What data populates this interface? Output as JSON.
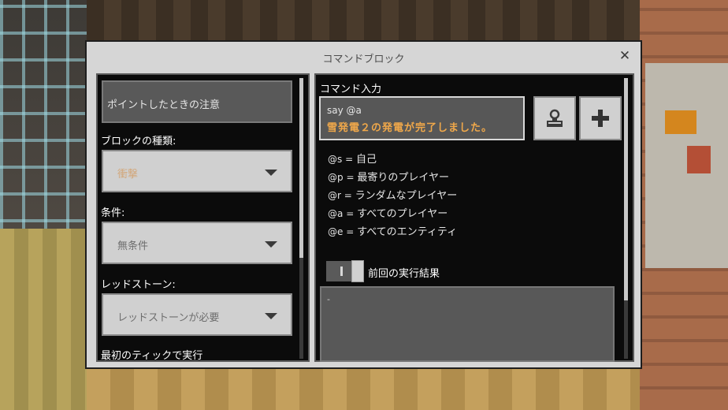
{
  "dialog": {
    "title": "コマンドブロック",
    "close_glyph": "✕"
  },
  "left": {
    "hover_note": "ポイントしたときの注意",
    "block_type": {
      "label": "ブロックの種類:",
      "value": "衝撃"
    },
    "condition": {
      "label": "条件:",
      "value": "無条件"
    },
    "redstone": {
      "label": "レッドストーン:",
      "value": "レッドストーンが必要"
    },
    "first_tick_label": "最初のティックで実行"
  },
  "right": {
    "command_label": "コマンド入力",
    "command_value": "say @a",
    "command_preview": "雪発電２の発電が完了しました。",
    "buttons": {
      "history_icon": "stamp-icon",
      "add_icon": "plus-icon"
    },
    "selectors": [
      {
        "key": "@s",
        "eq": "=",
        "desc": "自己"
      },
      {
        "key": "@p",
        "eq": "=",
        "desc": "最寄りのプレイヤー"
      },
      {
        "key": "@r",
        "eq": "=",
        "desc": "ランダムなプレイヤー"
      },
      {
        "key": "@a",
        "eq": "=",
        "desc": "すべてのプレイヤー"
      },
      {
        "key": "@e",
        "eq": "=",
        "desc": "すべてのエンティティ"
      }
    ],
    "toggle_label": "前回の実行結果",
    "previous_output": "-"
  },
  "colors": {
    "dialog_bg": "#d6d6d6",
    "panel_bg": "#0b0b0b",
    "preview_text": "#f0a84a",
    "dropdown_accent_text": "#d2a77a"
  }
}
